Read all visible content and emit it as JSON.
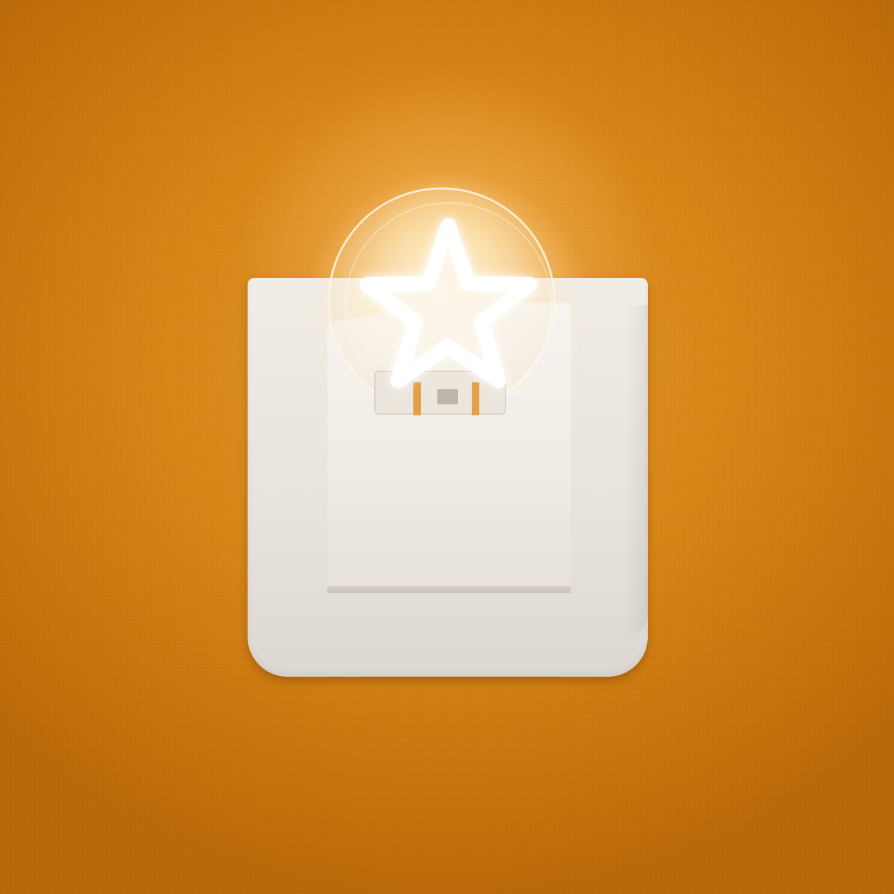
{
  "scene": {
    "description_free": true,
    "colors": {
      "wall": "#d88718",
      "wall_glow": "#ffe196",
      "plastic": "#efebe5",
      "star_light": "#ffffff",
      "led_pins": "#e0a14a"
    },
    "icons": {
      "lamp_shape": "star-icon"
    }
  }
}
